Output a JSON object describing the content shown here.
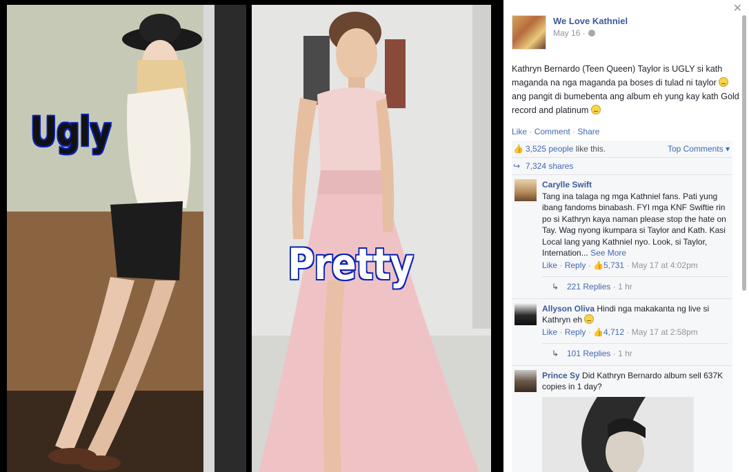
{
  "photos": {
    "left_label": "Ugly",
    "right_label": "Pretty"
  },
  "post": {
    "page_name": "We Love Kathniel",
    "date": "May 16 ·",
    "text_part1": "Kathryn Bernardo (Teen Queen) Taylor is UGLY si kath maganda na nga maganda pa boses di tulad ni taylor",
    "text_part2": "ang pangit di bumebenta ang album eh yung kay kath Gold record and platinum",
    "like": "Like",
    "comment": "Comment",
    "share": "Share",
    "sep": "·"
  },
  "ufi": {
    "likes_count": "3,525 people",
    "likes_suffix": " like this.",
    "top_comments": "Top Comments ▾",
    "shares": "7,324 shares"
  },
  "comments": [
    {
      "name": "Carylle Swift",
      "text": "Tang ina talaga ng mga Kathniel fans. Pati yung ibang fandoms binabash. FYI mga KNF Swiftie rin po si Kathryn kaya naman please stop the hate on Tay. Wag nyong ikumpara si Taylor and Kath. Kasi Local lang yang Kathniel nyo. Look, si Taylor, Internation...",
      "see_more": "See More",
      "like": "Like",
      "reply": "Reply",
      "likes": "5,731",
      "time": "May 17 at 4:02pm",
      "replies": "221 Replies",
      "replies_time": "1 hr"
    },
    {
      "name": "Allyson Oliva",
      "text": "Hindi nga makakanta ng live si Kathryn eh",
      "like": "Like",
      "reply": "Reply",
      "likes": "4,712",
      "time": "May 17 at 2:58pm",
      "replies": "101 Replies",
      "replies_time": "1 hr"
    },
    {
      "name": "Prince Sy",
      "text": "Did Kathryn Bernardo album sell 637K copies in 1 day?"
    }
  ]
}
